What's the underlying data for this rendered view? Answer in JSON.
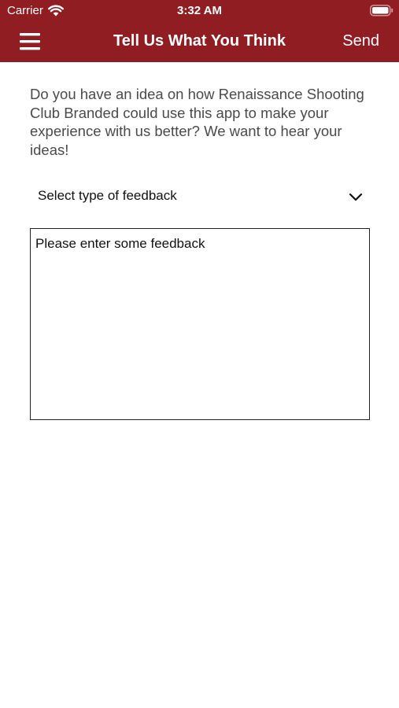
{
  "status_bar": {
    "carrier": "Carrier",
    "time": "3:32 AM",
    "wifi_icon": "wifi-icon",
    "battery_icon": "battery-icon"
  },
  "nav_bar": {
    "menu_icon": "hamburger-menu-icon",
    "title": "Tell Us What You Think",
    "send_label": "Send",
    "background_color": "#8f1d22",
    "text_color": "#ffffff"
  },
  "main": {
    "intro_text": "Do you have an idea on how Renaissance Shooting Club Branded could use this app to make your experience with us better? We want to hear your ideas!",
    "feedback_type": {
      "selected_label": "Select type of feedback",
      "chevron_icon": "chevron-down-icon"
    },
    "feedback_input": {
      "value": "",
      "placeholder": "Please enter some feedback"
    }
  }
}
